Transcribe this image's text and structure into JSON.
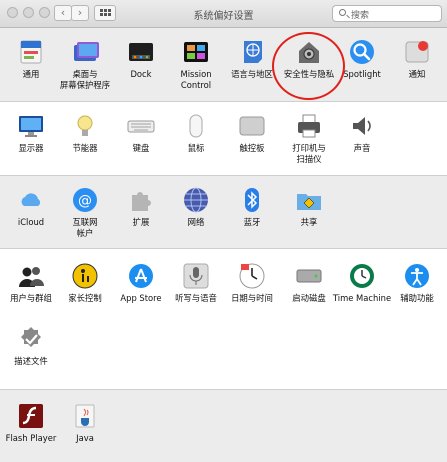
{
  "window": {
    "title": "系统偏好设置"
  },
  "toolbar": {
    "back": "‹",
    "forward": "›",
    "search_placeholder": "搜索"
  },
  "rows": [
    {
      "items": [
        {
          "name": "general",
          "label": "通用",
          "icon": "general-icon"
        },
        {
          "name": "desktop-screensaver",
          "label": "桌面与\n屏幕保护程序",
          "icon": "desktop-screensaver-icon"
        },
        {
          "name": "dock",
          "label": "Dock",
          "icon": "dock-icon"
        },
        {
          "name": "mission-control",
          "label": "Mission\nControl",
          "icon": "mission-control-icon"
        },
        {
          "name": "language-region",
          "label": "语言与地区",
          "icon": "language-region-icon"
        },
        {
          "name": "security-privacy",
          "label": "安全性与隐私",
          "icon": "security-house-icon"
        },
        {
          "name": "spotlight",
          "label": "Spotlight",
          "icon": "spotlight-icon"
        },
        {
          "name": "notifications",
          "label": "通知",
          "icon": "notifications-icon"
        }
      ]
    },
    {
      "items": [
        {
          "name": "displays",
          "label": "显示器",
          "icon": "display-icon"
        },
        {
          "name": "energy-saver",
          "label": "节能器",
          "icon": "lightbulb-icon"
        },
        {
          "name": "keyboard",
          "label": "键盘",
          "icon": "keyboard-icon"
        },
        {
          "name": "mouse",
          "label": "鼠标",
          "icon": "mouse-icon"
        },
        {
          "name": "trackpad",
          "label": "触控板",
          "icon": "trackpad-icon"
        },
        {
          "name": "printers-scanners",
          "label": "打印机与\n扫描仪",
          "icon": "printer-icon"
        },
        {
          "name": "sound",
          "label": "声音",
          "icon": "speaker-icon"
        }
      ]
    },
    {
      "items": [
        {
          "name": "icloud",
          "label": "iCloud",
          "icon": "icloud-icon"
        },
        {
          "name": "internet-accounts",
          "label": "互联网\n帐户",
          "icon": "at-icon"
        },
        {
          "name": "extensions",
          "label": "扩展",
          "icon": "puzzle-icon"
        },
        {
          "name": "network",
          "label": "网络",
          "icon": "globe-icon"
        },
        {
          "name": "bluetooth",
          "label": "蓝牙",
          "icon": "bluetooth-icon"
        },
        {
          "name": "sharing",
          "label": "共享",
          "icon": "sharing-folder-icon"
        }
      ]
    },
    {
      "items": [
        {
          "name": "users-groups",
          "label": "用户与群组",
          "icon": "users-icon"
        },
        {
          "name": "parental-controls",
          "label": "家长控制",
          "icon": "parental-icon"
        },
        {
          "name": "app-store",
          "label": "App Store",
          "icon": "app-store-icon"
        },
        {
          "name": "dictation-speech",
          "label": "听写与语音",
          "icon": "microphone-icon"
        },
        {
          "name": "date-time",
          "label": "日期与时间",
          "icon": "clock-icon"
        },
        {
          "name": "startup-disk",
          "label": "启动磁盘",
          "icon": "disk-icon"
        },
        {
          "name": "time-machine",
          "label": "Time Machine",
          "icon": "time-machine-icon"
        },
        {
          "name": "accessibility",
          "label": "辅助功能",
          "icon": "accessibility-icon"
        },
        {
          "name": "profiles",
          "label": "描述文件",
          "icon": "checkmark-badge-icon"
        }
      ]
    },
    {
      "items": [
        {
          "name": "flash-player",
          "label": "Flash Player",
          "icon": "flash-icon"
        },
        {
          "name": "java",
          "label": "Java",
          "icon": "java-cup-icon"
        }
      ]
    }
  ],
  "colors": {
    "highlight_circle": "#e0201a",
    "section_gray": "#ececec",
    "accent_blue": "#1c8ef0"
  }
}
